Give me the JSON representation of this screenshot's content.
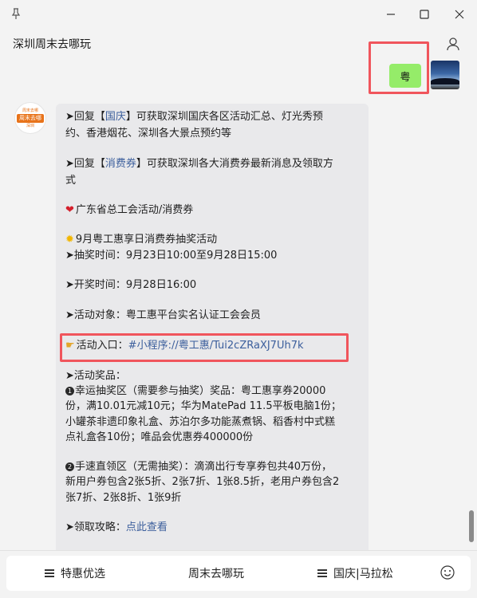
{
  "window": {
    "pin_icon": "pin-icon",
    "controls": [
      "minimize-icon",
      "maximize-icon",
      "close-icon"
    ]
  },
  "header": {
    "title": "深圳周末去哪玩",
    "contact_icon": "person-icon"
  },
  "my_message": {
    "text": "粤"
  },
  "bot_avatar": {
    "top": "周末去哪",
    "mid": "周末去哪",
    "bottom": "深圳"
  },
  "bot_message": {
    "l1_pre": "➤回复【",
    "l1_kw": "国庆",
    "l1_post": "】可获取深圳国庆各区活动汇总、灯光秀预",
    "l2": "约、香港烟花、深圳各大景点预约等",
    "l3_pre": "➤回复【",
    "l3_kw": "消费券",
    "l3_post": "】可获取深圳各大消费券最新消息及领取方",
    "l4": "式",
    "l5": "广东省总工会活动/消费券",
    "l6": "9月粤工惠享日消费券抽奖活动",
    "l7": "➤抽奖时间：9月23日10:00至9月28日15:00",
    "l8": "➤开奖时间：9月28日16:00",
    "l9": "➤活动对象：粤工惠平台实名认证工会会员",
    "l10_pre": "活动入口：",
    "l10_link": "#小程序://粤工惠/Tui2cZRaXJ7Uh7k",
    "l11": "➤活动奖品：",
    "l12_num": "1",
    "l12": "幸运抽奖区（需要参与抽奖）奖品：粤工惠享券20000",
    "l13": "份，满10.01元减10元；华为MatePad 11.5平板电脑1份；",
    "l14": "小罐茶非遗印象礼盒、苏泊尔多功能蒸煮锅、稻香村中式糕",
    "l15": "点礼盒各10份；唯品会优惠券400000份",
    "l16_num": "2",
    "l16": "手速直领区（无需抽奖）：滴滴出行专享券包共40万份，",
    "l17": "新用户券包含2张5折、2张7折、1张8.5折，老用户券包含2",
    "l18": "张7折、2张8折、1张9折",
    "l19_pre": "➤领取攻略：",
    "l19_link": "点此查看"
  },
  "menu": {
    "item1": "特惠优选",
    "item2": "周末去哪玩",
    "item3": "国庆|马拉松",
    "emoji_icon": "emoji-icon"
  },
  "colors": {
    "highlight": "#f0555c",
    "my_bubble": "#95ec69",
    "link": "#3b5e9c",
    "brand_orange": "#e8731a"
  }
}
